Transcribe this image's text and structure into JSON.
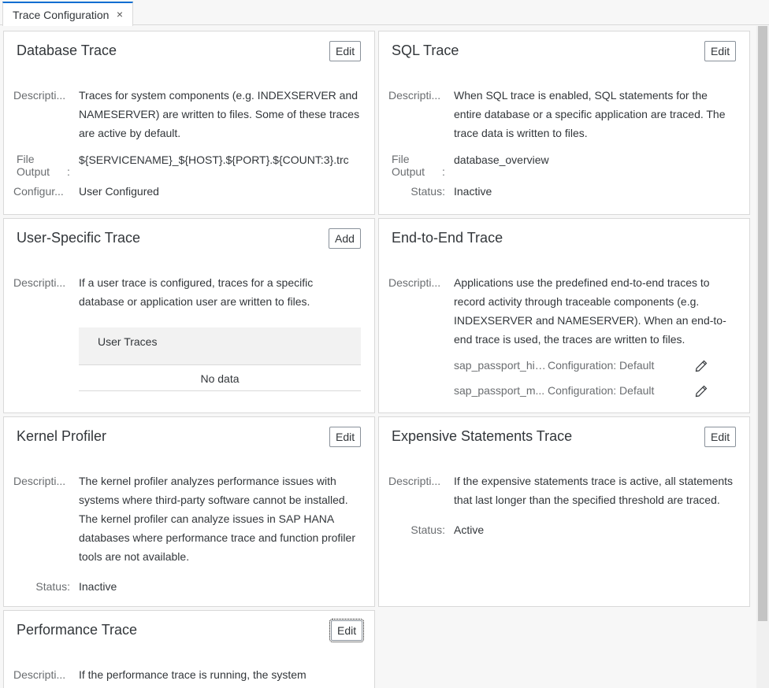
{
  "tab": {
    "title": "Trace Configuration",
    "close": "×"
  },
  "cards": {
    "database": {
      "title": "Database Trace",
      "button": "Edit",
      "desc_label": "Descripti...",
      "description": "Traces for system components (e.g. INDEXSERVER and NAMESERVER) are written to files. Some of these traces are active by default.",
      "file_output_label_1": "File",
      "file_output_label_2": "Output",
      "colon": ":",
      "file_output": "${SERVICENAME}_${HOST}.${PORT}.${COUNT:3}.trc",
      "config_label": "Configur...",
      "config_value": "User Configured"
    },
    "sql": {
      "title": "SQL Trace",
      "button": "Edit",
      "desc_label": "Descripti...",
      "description": "When SQL trace is enabled, SQL statements for the entire database or a specific application are traced. The trace data is written to files.",
      "file_output_label_1": "File",
      "file_output_label_2": "Output",
      "colon": ":",
      "file_output": "database_overview",
      "status_label": "Status:",
      "status": "Inactive"
    },
    "user": {
      "title": "User-Specific Trace",
      "button": "Add",
      "desc_label": "Descripti...",
      "description": "If a user trace is configured, traces for a specific database or application user are written to files.",
      "table_header": "User Traces",
      "no_data": "No data"
    },
    "e2e": {
      "title": "End-to-End Trace",
      "desc_label": "Descripti...",
      "description": "Applications use the predefined end-to-end traces to record activity through traceable components (e.g. INDEXSERVER and NAMESERVER). When an end-to-end trace is used, the traces are written to files.",
      "items": [
        {
          "name": "sap_passport_high",
          "config": "Configuration: Default"
        },
        {
          "name": "sap_passport_m...",
          "config": "Configuration: Default"
        }
      ]
    },
    "kernel": {
      "title": "Kernel Profiler",
      "button": "Edit",
      "desc_label": "Descripti...",
      "description": "The kernel profiler analyzes performance issues with systems where third-party software cannot be installed. The kernel profiler can analyze issues in SAP HANA databases where performance trace and function profiler tools are not available.",
      "status_label": "Status:",
      "status": "Inactive"
    },
    "expensive": {
      "title": "Expensive Statements Trace",
      "button": "Edit",
      "desc_label": "Descripti...",
      "description": "If the expensive statements trace is active, all statements that last longer than the specified threshold are traced.",
      "status_label": "Status:",
      "status": "Active"
    },
    "performance": {
      "title": "Performance Trace",
      "button": "Edit",
      "desc_label": "Descripti...",
      "description": "If the performance trace is running, the system"
    }
  },
  "colors": {
    "accent": "#0a6ed1",
    "border": "#d9d9d9",
    "text": "#32363a",
    "label": "#6a6d70"
  },
  "icons": {
    "edit": "pencil-icon",
    "close": "close-icon"
  }
}
